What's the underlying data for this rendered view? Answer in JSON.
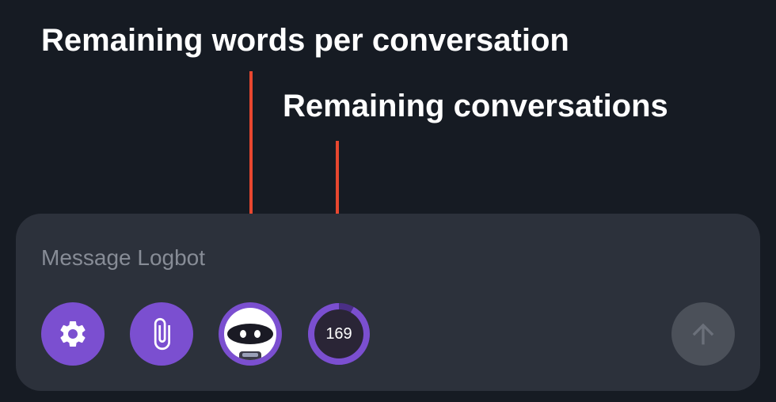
{
  "annotations": {
    "words_label": "Remaining words per conversation",
    "conversations_label": "Remaining conversations"
  },
  "composer": {
    "placeholder": "Message Logbot",
    "value": ""
  },
  "toolbar": {
    "settings_icon": "gear-icon",
    "attach_icon": "paperclip-icon",
    "model_icon": "robot-avatar-icon",
    "send_icon": "arrow-up-icon"
  },
  "conversation_counter": {
    "remaining": "169",
    "progress_fraction": 0.92
  },
  "colors": {
    "background": "#161b23",
    "composer": "#2c313b",
    "accent": "#7b4fd0",
    "arrow": "#e8472f",
    "send_disabled": "#4b5059"
  }
}
